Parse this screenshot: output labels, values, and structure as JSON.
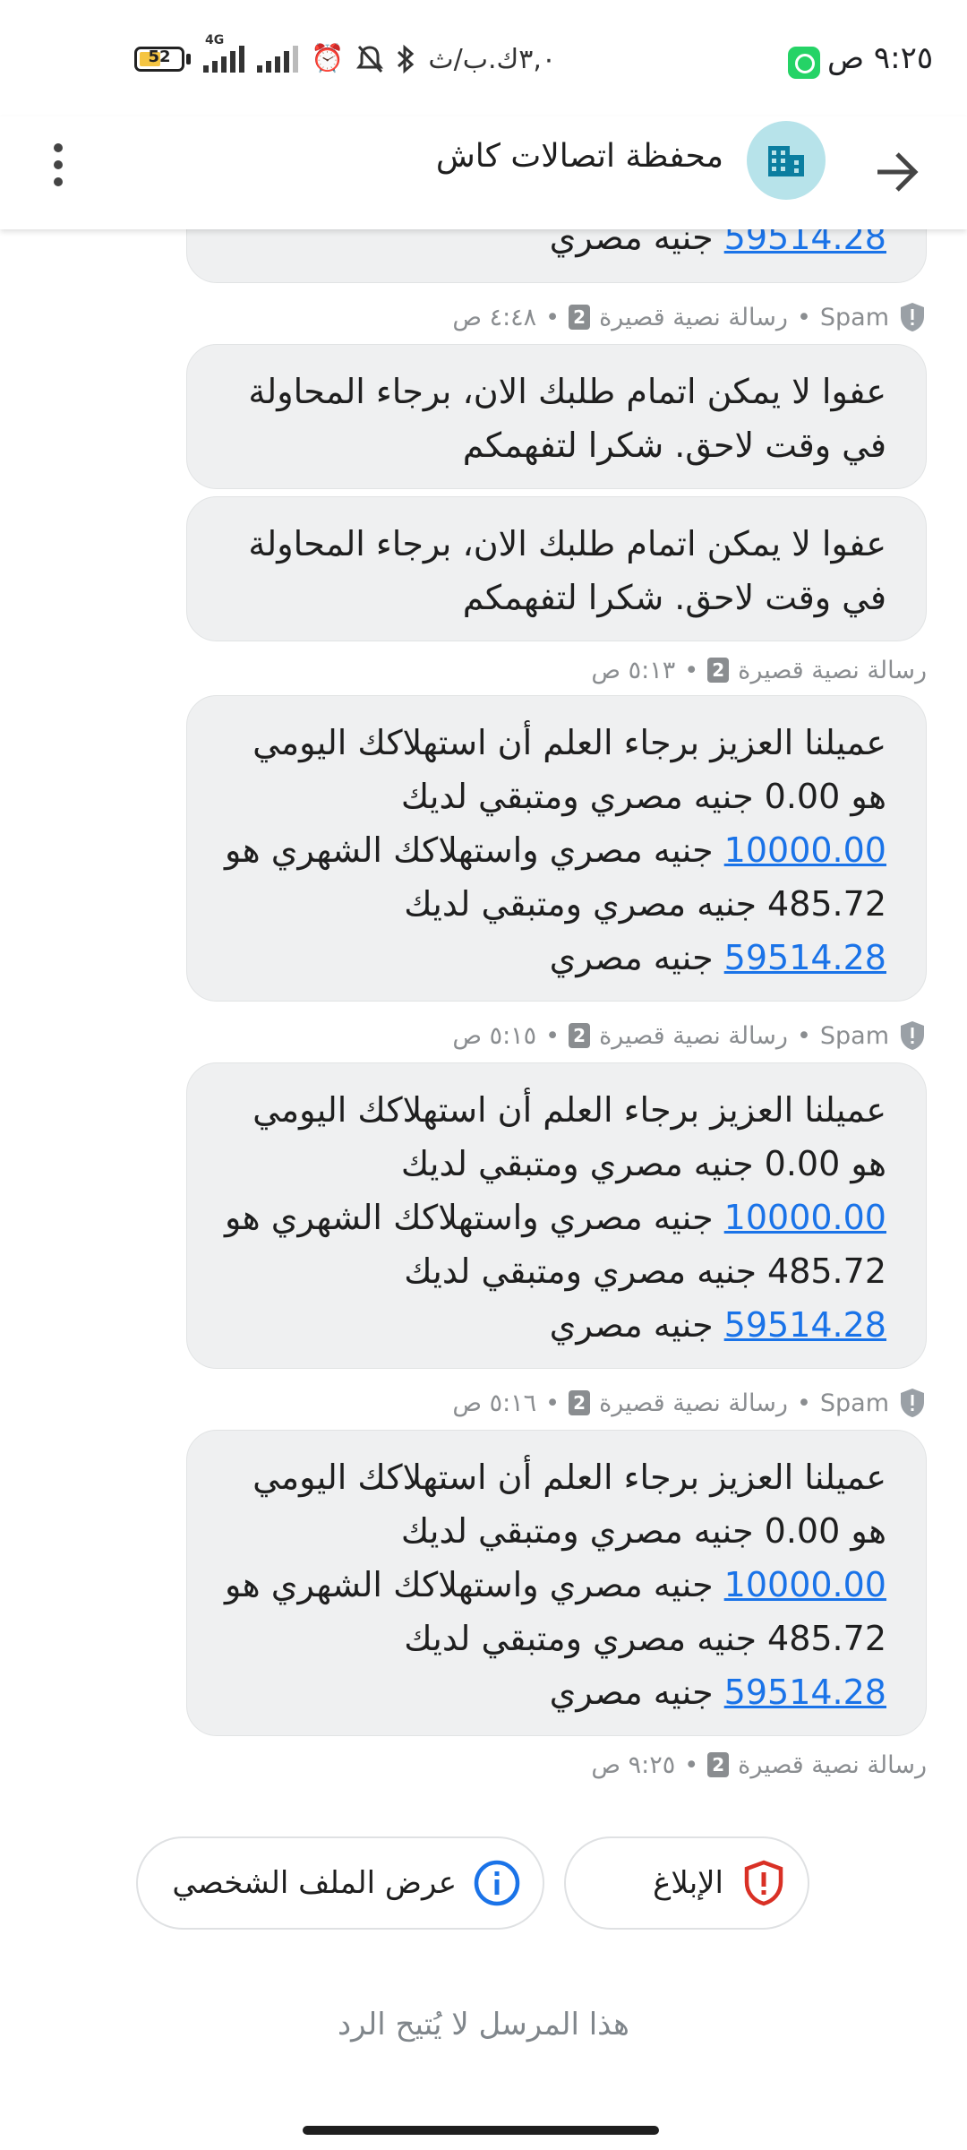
{
  "status_bar": {
    "time": "٩:٢٥ ص",
    "network_speed": "٣,٠ك.ب/ث",
    "network_type": "4G",
    "battery": "52",
    "battery_level": 0.52,
    "icons": [
      "whatsapp-icon",
      "bluetooth-icon",
      "mute-bell-icon",
      "alarm-icon",
      "signal-icon",
      "battery-icon"
    ]
  },
  "app_bar": {
    "contact_name": "محفظة اتصالات كاش",
    "avatar_icon": "building-icon",
    "back_icon": "arrow-forward-icon",
    "menu_icon": "more-vertical-icon"
  },
  "messages": {
    "m0": {
      "amount": "59514.28",
      "text": "جنيه مصري"
    },
    "meta1": {
      "spam": "Spam",
      "separator": "•",
      "type": "رسالة نصية قصيرة",
      "sim": "2",
      "time": "٤:٤٨ ص"
    },
    "m1": {
      "line1": "عفوا لا يمكن اتمام طلبك الان، برجاء المحاولة",
      "line2": "في وقت لاحق. شكرا لتفهمكم"
    },
    "m2": {
      "line1": "عفوا لا يمكن اتمام طلبك الان، برجاء المحاولة",
      "line2": "في وقت لاحق. شكرا لتفهمكم"
    },
    "meta2": {
      "separator": "•",
      "type": "رسالة نصية قصيرة",
      "sim": "2",
      "time": "٥:١٣ ص"
    },
    "m3": {
      "line1": "عميلنا العزيز برجاء العلم أن استهلاكك اليومي",
      "line2": "هو 0.00 جنيه مصري ومتبقي لديك",
      "amount1": "10000.00",
      "line3": "جنيه مصري واستهلاكك الشهري هو",
      "line4": "485.72 جنيه مصري ومتبقي لديك",
      "amount2": "59514.28",
      "line5": "جنيه مصري"
    },
    "meta3": {
      "spam": "Spam",
      "separator": "•",
      "type": "رسالة نصية قصيرة",
      "sim": "2",
      "time": "٥:١٥ ص"
    },
    "m4": {
      "line1": "عميلنا العزيز برجاء العلم أن استهلاكك اليومي",
      "line2": "هو 0.00 جنيه مصري ومتبقي لديك",
      "amount1": "10000.00",
      "line3": "جنيه مصري واستهلاكك الشهري هو",
      "line4": "485.72 جنيه مصري ومتبقي لديك",
      "amount2": "59514.28",
      "line5": "جنيه مصري"
    },
    "meta4": {
      "spam": "Spam",
      "separator": "•",
      "type": "رسالة نصية قصيرة",
      "sim": "2",
      "time": "٥:١٦ ص"
    },
    "m5": {
      "line1": "عميلنا العزيز برجاء العلم أن استهلاكك اليومي",
      "line2": "هو 0.00 جنيه مصري ومتبقي لديك",
      "amount1": "10000.00",
      "line3": "جنيه مصري واستهلاكك الشهري هو",
      "line4": "485.72 جنيه مصري ومتبقي لديك",
      "amount2": "59514.28",
      "line5": "جنيه مصري"
    },
    "meta5": {
      "separator": "•",
      "type": "رسالة نصية قصيرة",
      "sim": "2",
      "time": "٩:٢٥ ص"
    }
  },
  "actions": {
    "report_label": "الإبلاغ",
    "report_icon": "shield-alert-icon",
    "profile_label": "عرض الملف الشخصي",
    "profile_icon": "info-icon"
  },
  "footer": {
    "no_reply": "هذا المرسل لا يُتيح الرد"
  },
  "colors": {
    "accent": "#1a73e8",
    "bubble": "#eff0f1",
    "report_red": "#d93025",
    "avatar_bg": "#b7e3ea"
  }
}
